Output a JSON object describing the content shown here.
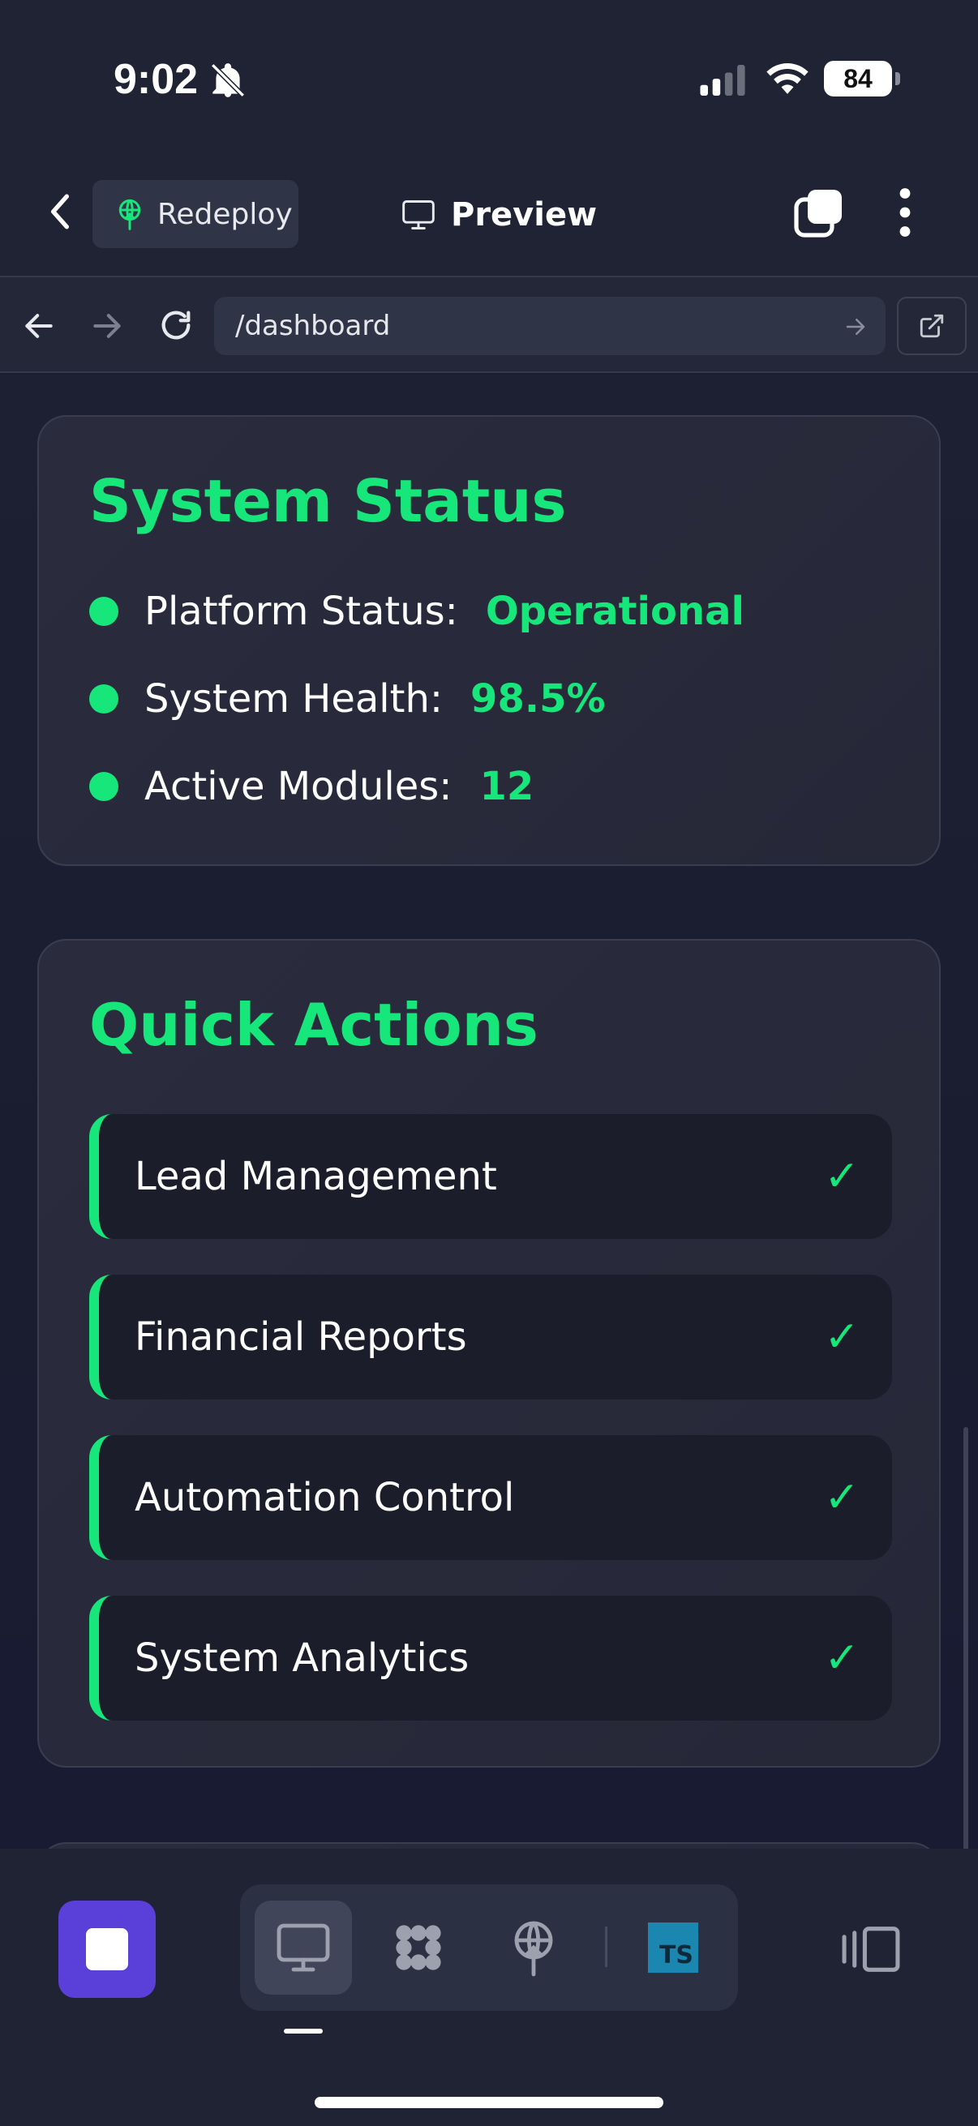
{
  "status_bar": {
    "time": "9:02",
    "battery": "84"
  },
  "nav": {
    "redeploy_label": "Redeploy",
    "preview_label": "Preview"
  },
  "browser": {
    "url": "/dashboard"
  },
  "system_status": {
    "title": "System Status",
    "items": [
      {
        "label": "Platform Status:",
        "value": "Operational"
      },
      {
        "label": "System Health:",
        "value": "98.5%"
      },
      {
        "label": "Active Modules:",
        "value": "12"
      }
    ]
  },
  "quick_actions": {
    "title": "Quick Actions",
    "items": [
      {
        "label": "Lead Management",
        "check": "✓"
      },
      {
        "label": "Financial Reports",
        "check": "✓"
      },
      {
        "label": "Automation Control",
        "check": "✓"
      },
      {
        "label": "System Analytics",
        "check": "✓"
      }
    ]
  },
  "toolbar": {
    "ts_label": "TS"
  },
  "colors": {
    "accent": "#17e67a",
    "background": "#1a1d2e",
    "card": "#2a2c3e",
    "stop_button": "#5a3fd9"
  },
  "icons": [
    "bell-slash-icon",
    "signal-icon",
    "wifi-icon",
    "chevron-left-icon",
    "redeploy-icon",
    "monitor-icon",
    "tabs-icon",
    "more-vertical-icon",
    "arrow-left-icon",
    "arrow-right-icon",
    "reload-icon",
    "external-link-icon",
    "stop-icon",
    "preview-desktop-icon",
    "integrations-icon",
    "deploy-icon",
    "typescript-icon",
    "panel-toggle-icon"
  ]
}
